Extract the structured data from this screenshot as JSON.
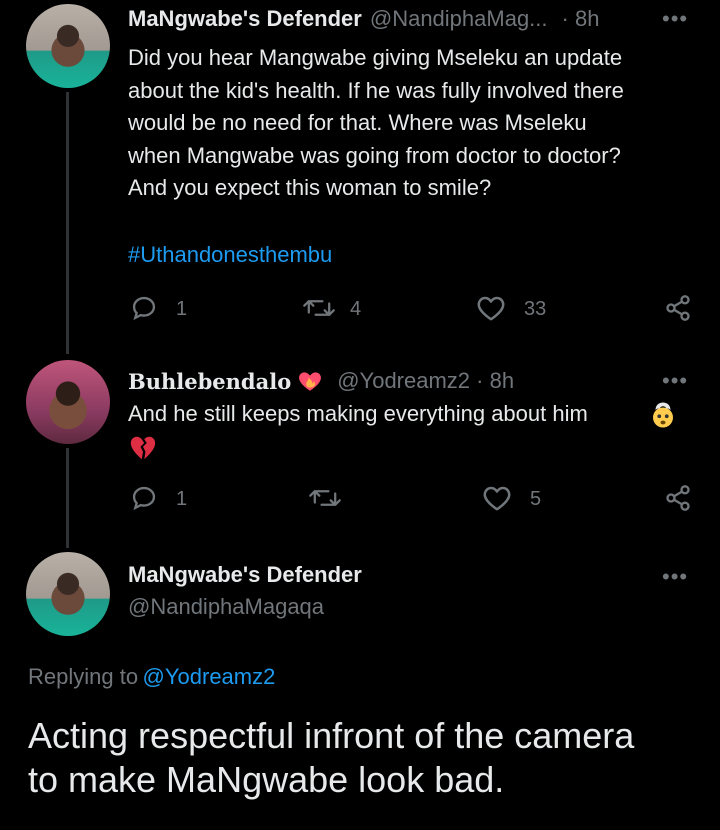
{
  "tweet1": {
    "display_name": "MaNgwabe's Defender",
    "handle": "@NandiphaMag...",
    "time": "· 8h",
    "more": "•••",
    "text_lines": [
      "Did you hear Mangwabe giving Mseleku an update",
      "about the kid's health. If he was fully involved there",
      "would be no need for that. Where was Mseleku",
      "when Mangwabe was going from doctor to doctor?",
      "And you expect this woman to smile?"
    ],
    "hashtag": "#Uthandonesthembu",
    "reply_count": "1",
    "retweet_count": "4",
    "like_count": "33"
  },
  "tweet2": {
    "display_name": "Buhlebendalo",
    "handle": "@Yodreamz2 · 8h",
    "more": "•••",
    "text": "And he still keeps making everything about him",
    "reply_count": "1",
    "retweet_count": "",
    "like_count": "5"
  },
  "tweet3": {
    "display_name": "MaNgwabe's Defender",
    "handle": "@NandiphaMagaqa",
    "more": "•••",
    "replying_prefix": "Replying to",
    "replying_handle": "@Yodreamz2",
    "text_lines": [
      "Acting respectful infront of the camera",
      "to make MaNgwabe look bad."
    ]
  },
  "colors": {
    "background": "#000000",
    "text": "#e7e9ea",
    "muted": "#71767b",
    "link": "#1d9bf0"
  }
}
